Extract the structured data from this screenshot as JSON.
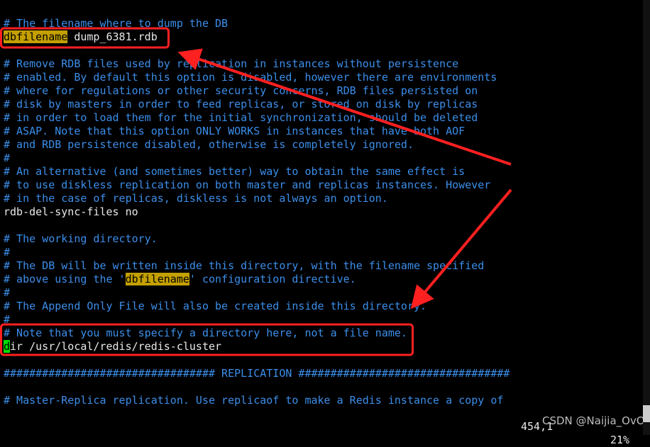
{
  "lines": [
    {
      "type": "comment",
      "text": "# The filename where to dump the DB"
    },
    {
      "type": "kv",
      "key": "dbfilename",
      "value": " dump_6381.rdb"
    },
    {
      "type": "blank",
      "text": ""
    },
    {
      "type": "comment",
      "text": "# Remove RDB files used by replication in instances without persistence"
    },
    {
      "type": "comment",
      "text": "# enabled. By default this option is disabled, however there are environments"
    },
    {
      "type": "comment",
      "text": "# where for regulations or other security concerns, RDB files persisted on"
    },
    {
      "type": "comment",
      "text": "# disk by masters in order to feed replicas, or stored on disk by replicas"
    },
    {
      "type": "comment",
      "text": "# in order to load them for the initial synchronization, should be deleted"
    },
    {
      "type": "comment",
      "text": "# ASAP. Note that this option ONLY WORKS in instances that have both AOF"
    },
    {
      "type": "comment",
      "text": "# and RDB persistence disabled, otherwise is completely ignored."
    },
    {
      "type": "comment",
      "text": "#"
    },
    {
      "type": "comment",
      "text": "# An alternative (and sometimes better) way to obtain the same effect is"
    },
    {
      "type": "comment",
      "text": "# to use diskless replication on both master and replicas instances. However"
    },
    {
      "type": "comment",
      "text": "# in the case of replicas, diskless is not always an option."
    },
    {
      "type": "plain",
      "text": "rdb-del-sync-files no"
    },
    {
      "type": "blank",
      "text": ""
    },
    {
      "type": "comment",
      "text": "# The working directory."
    },
    {
      "type": "comment",
      "text": "#"
    },
    {
      "type": "comment",
      "text": "# The DB will be written inside this directory, with the filename specified"
    },
    {
      "type": "comment-hl",
      "before": "# above using the '",
      "hl": "dbfilename",
      "after": "' configuration directive."
    },
    {
      "type": "comment",
      "text": "#"
    },
    {
      "type": "comment",
      "text": "# The Append Only File will also be created inside this directory."
    },
    {
      "type": "comment",
      "text": "#"
    },
    {
      "type": "comment",
      "text": "# Note that you must specify a directory here, not a file name."
    },
    {
      "type": "cursor",
      "cur": "d",
      "rest": "ir /usr/local/redis/redis-cluster"
    },
    {
      "type": "blank",
      "text": ""
    },
    {
      "type": "comment",
      "text": "################################# REPLICATION #################################"
    },
    {
      "type": "blank",
      "text": ""
    },
    {
      "type": "comment",
      "text": "# Master-Replica replication. Use replicaof to make a Redis instance a copy of"
    }
  ],
  "status": {
    "position": "454,1",
    "percent": "21%"
  },
  "watermark": "CSDN @Naijia_OvO",
  "colors": {
    "background": "#000000",
    "comment": "#3b8eea",
    "text": "#e8e8e8",
    "search_highlight": "#c4a000",
    "cursor": "#00e000",
    "annotation": "#ff2020"
  }
}
